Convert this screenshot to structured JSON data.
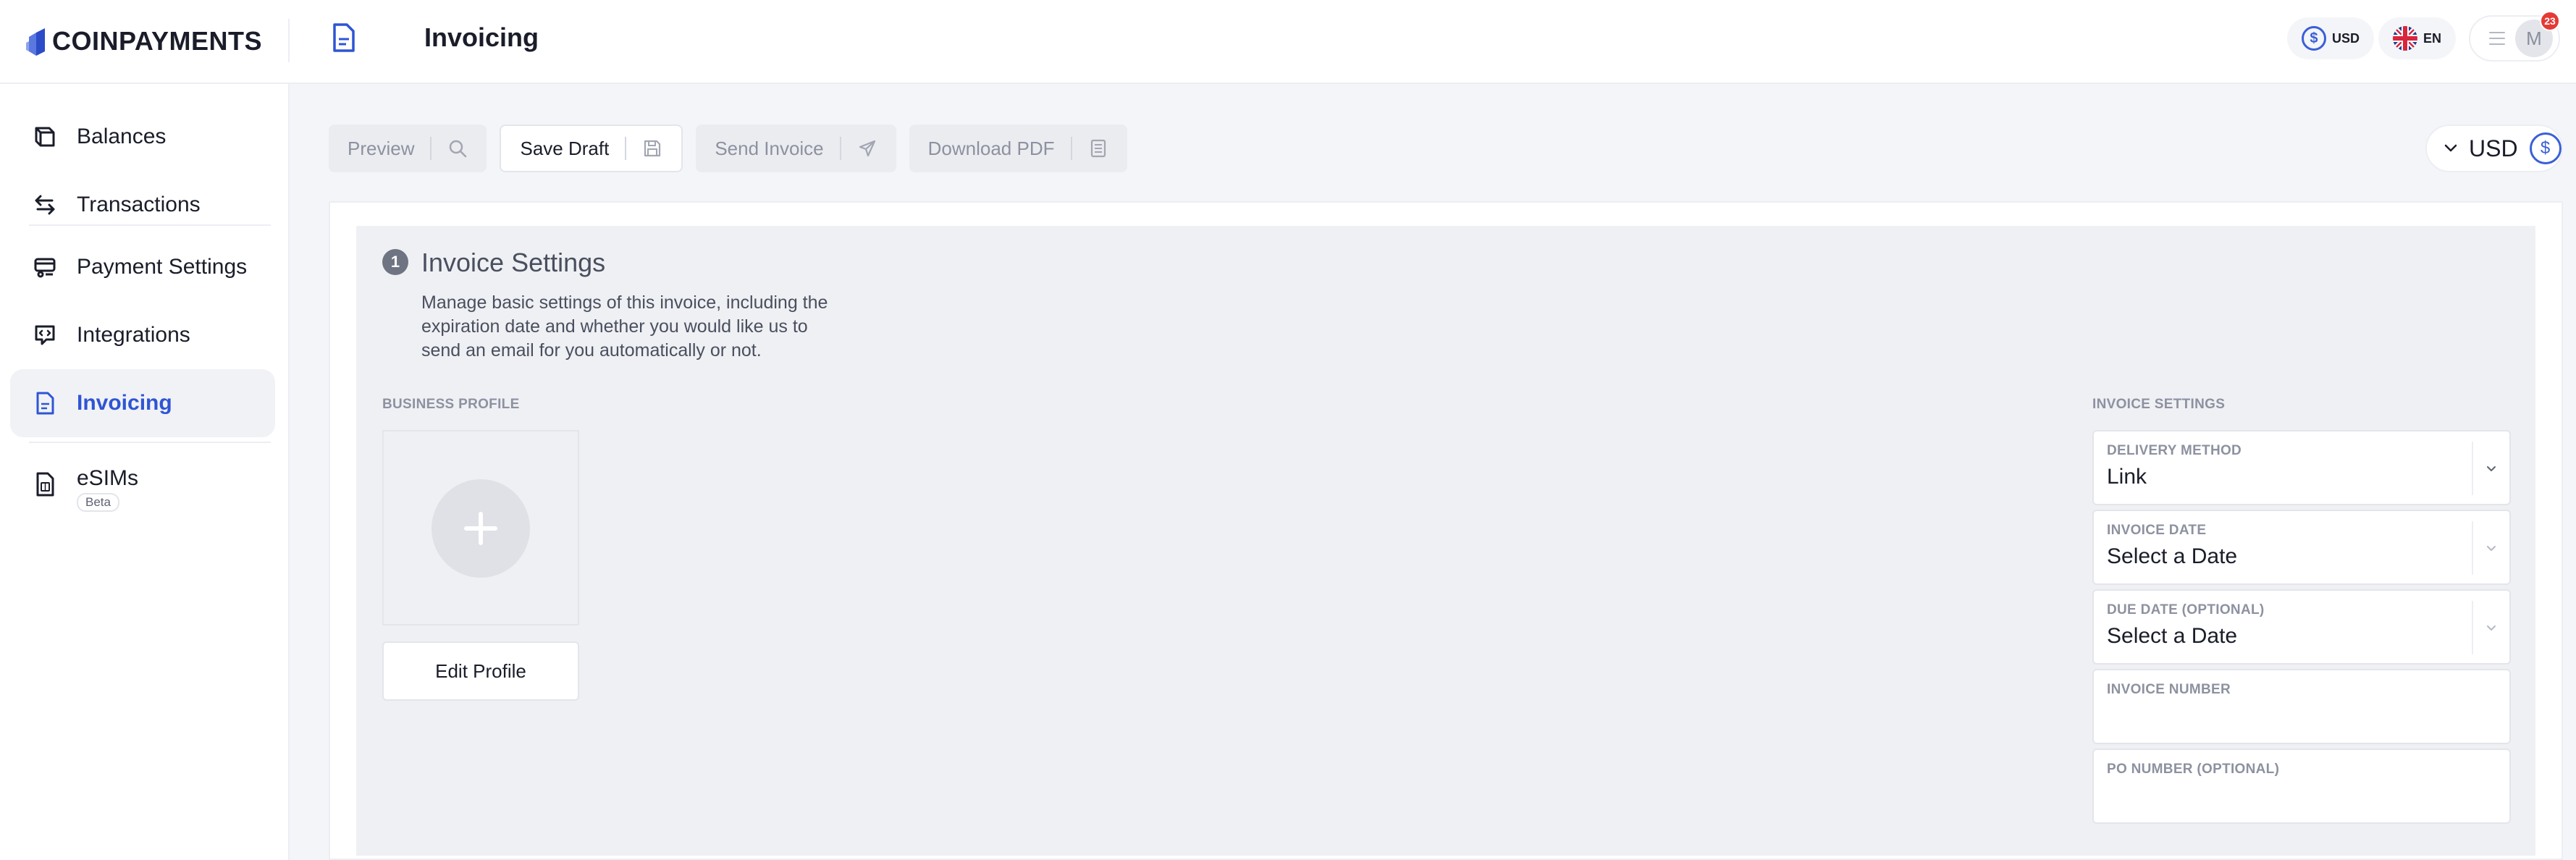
{
  "app": {
    "brand": "COINPAYMENTS",
    "page_title": "Invoicing"
  },
  "header": {
    "currency_code": "USD",
    "currency_symbol": "$",
    "language": "EN",
    "avatar_initial": "M",
    "notifications_count": "23"
  },
  "sidebar": {
    "items": [
      {
        "label": "Balances",
        "icon": "wallet-icon"
      },
      {
        "label": "Transactions",
        "icon": "arrows-icon"
      },
      {
        "label": "Payment Settings",
        "icon": "payment-settings-icon"
      },
      {
        "label": "Integrations",
        "icon": "integrations-icon"
      },
      {
        "label": "Invoicing",
        "icon": "invoice-icon",
        "active": true
      },
      {
        "label": "eSIMs",
        "icon": "sim-icon",
        "badge": "Beta"
      }
    ]
  },
  "toolbar": {
    "preview_label": "Preview",
    "save_draft_label": "Save Draft",
    "send_invoice_label": "Send Invoice",
    "download_pdf_label": "Download PDF"
  },
  "currency_select": {
    "label": "USD",
    "symbol": "$"
  },
  "section": {
    "step_number": "1",
    "title": "Invoice Settings",
    "description": "Manage basic settings of this invoice, including the expiration date and whether you would like us to send an email for you automatically or not."
  },
  "business_profile": {
    "label": "BUSINESS PROFILE",
    "edit_button": "Edit Profile"
  },
  "invoice_settings": {
    "label": "INVOICE SETTINGS",
    "fields": [
      {
        "label": "DELIVERY METHOD",
        "value": "Link"
      },
      {
        "label": "INVOICE DATE",
        "value": "Select a Date"
      },
      {
        "label": "DUE DATE (OPTIONAL)",
        "value": "Select a Date"
      },
      {
        "label": "INVOICE NUMBER",
        "value": ""
      },
      {
        "label": "PO NUMBER (OPTIONAL)",
        "value": ""
      }
    ]
  },
  "colors": {
    "accent": "#2f55d4",
    "notification": "#e53935",
    "muted_text": "#8d91a0"
  }
}
